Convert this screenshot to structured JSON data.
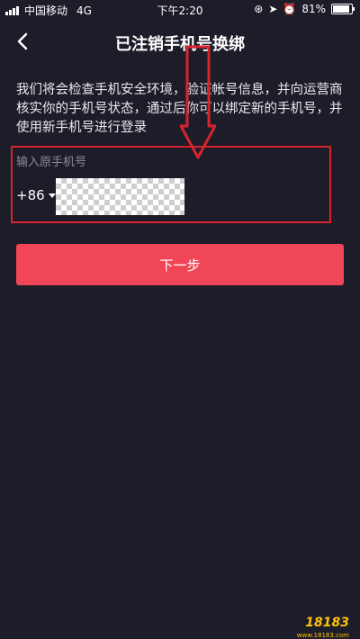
{
  "status_bar": {
    "carrier": "中国移动",
    "network": "4G",
    "time": "下午2:20",
    "battery": "81%",
    "battery_level": 0.81
  },
  "nav": {
    "title": "已注销手机号换绑",
    "back_icon": "chevron-left-icon"
  },
  "description": "我们将会检查手机安全环境，验证帐号信息，并向运营商核实你的手机号状态，通过后你可以绑定新的手机号，并使用新手机号进行登录",
  "form": {
    "field_label": "输入原手机号",
    "country_code": "+86"
  },
  "next_button": {
    "label": "下一步"
  },
  "colors": {
    "background": "#1d1d2a",
    "button": "#f04657",
    "annotation": "#d8232f"
  },
  "watermark": {
    "text": "18183",
    "sub": "www.18183.com"
  }
}
